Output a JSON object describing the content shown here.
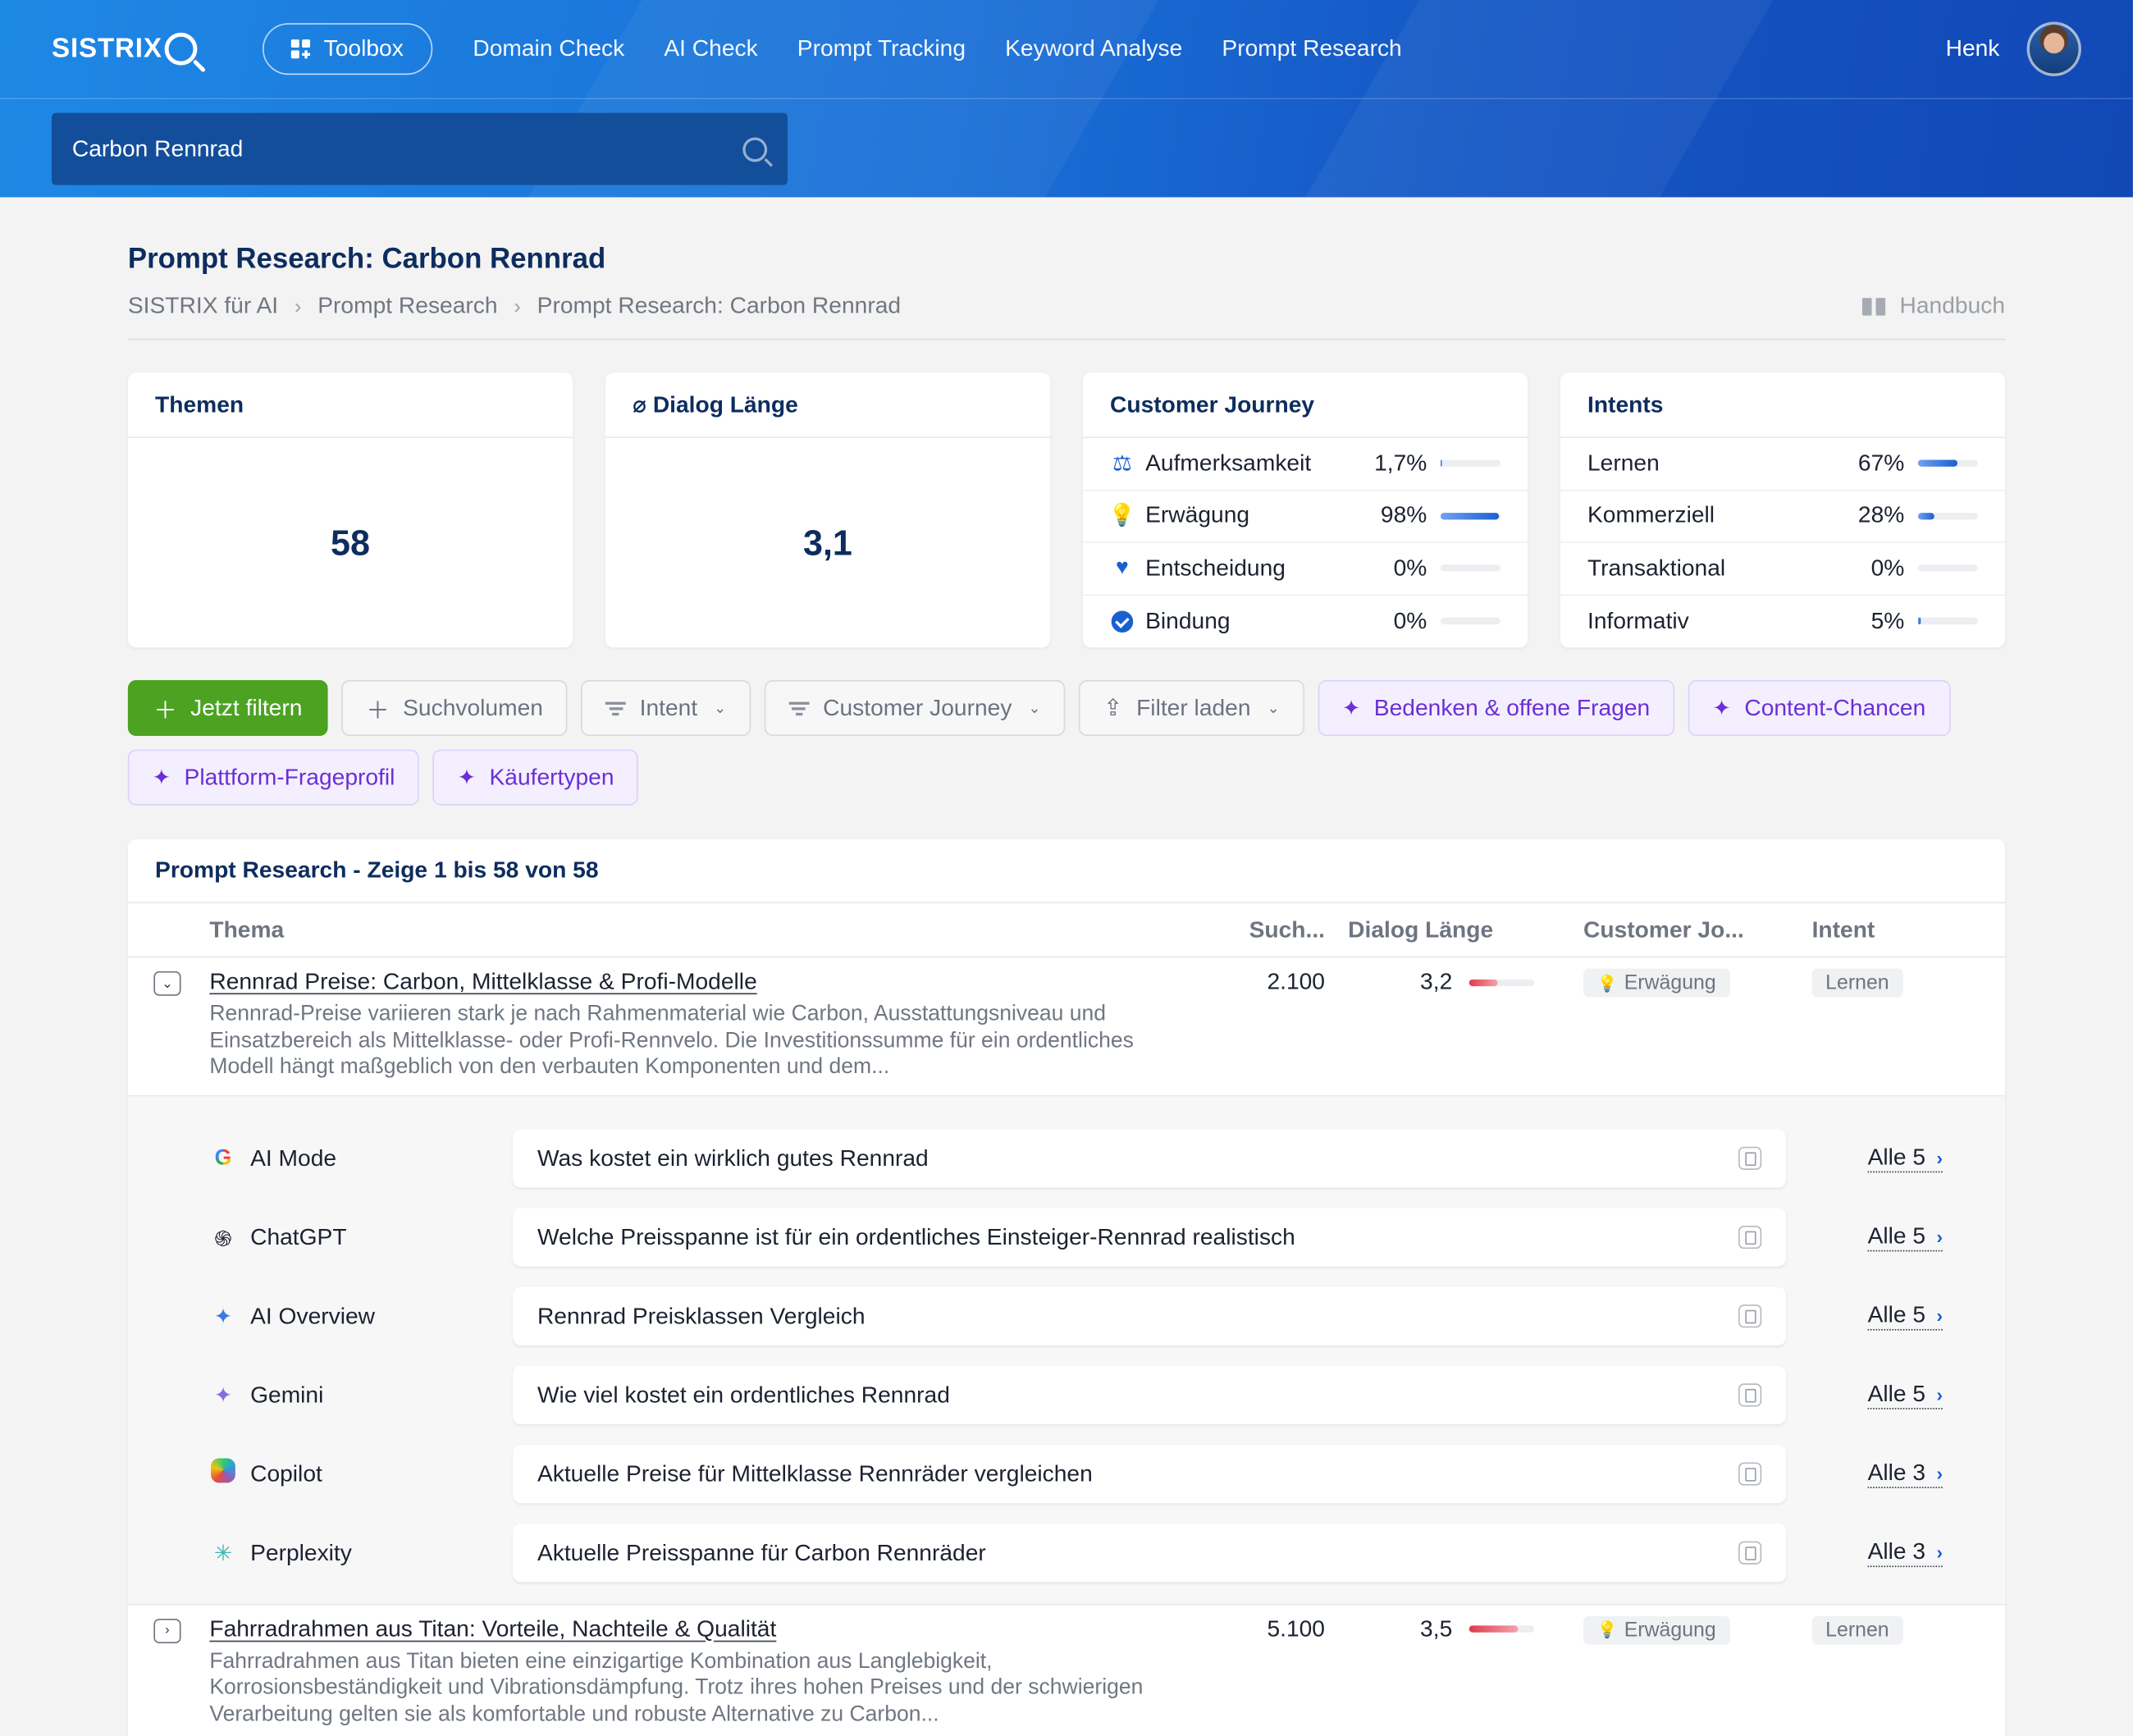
{
  "header": {
    "logo_text": "SISTRIX",
    "toolbox_label": "Toolbox",
    "nav": [
      "Domain Check",
      "AI Check",
      "Prompt Tracking",
      "Keyword Analyse",
      "Prompt Research"
    ],
    "user_name": "Henk",
    "search_value": "Carbon Rennrad"
  },
  "page": {
    "title": "Prompt Research: Carbon Rennrad",
    "breadcrumb": [
      "SISTRIX für AI",
      "Prompt Research",
      "Prompt Research: Carbon Rennrad"
    ],
    "handbook_label": "Handbuch"
  },
  "cards": {
    "themen": {
      "title": "Themen",
      "value": "58"
    },
    "dialog": {
      "title": "⌀ Dialog Länge",
      "value": "3,1"
    },
    "journey": {
      "title": "Customer Journey",
      "rows": [
        {
          "icon": "scale-icon",
          "label": "Aufmerksamkeit",
          "pct": "1,7%",
          "fraction": 0.017
        },
        {
          "icon": "bulb-icon",
          "label": "Erwägung",
          "pct": "98%",
          "fraction": 0.98
        },
        {
          "icon": "heart-icon",
          "label": "Entscheidung",
          "pct": "0%",
          "fraction": 0
        },
        {
          "icon": "check-circle-icon",
          "label": "Bindung",
          "pct": "0%",
          "fraction": 0
        }
      ]
    },
    "intents": {
      "title": "Intents",
      "rows": [
        {
          "label": "Lernen",
          "pct": "67%",
          "fraction": 0.67
        },
        {
          "label": "Kommerziell",
          "pct": "28%",
          "fraction": 0.28
        },
        {
          "label": "Transaktional",
          "pct": "0%",
          "fraction": 0
        },
        {
          "label": "Informativ",
          "pct": "5%",
          "fraction": 0.05
        }
      ]
    }
  },
  "filters": {
    "apply": "Jetzt filtern",
    "suchvolumen": "Suchvolumen",
    "intent": "Intent",
    "customer_journey": "Customer Journey",
    "filter_laden": "Filter laden",
    "bedenken": "Bedenken & offene Fragen",
    "content_chancen": "Content-Chancen",
    "plattform": "Plattform-Frageprofil",
    "kaeufertypen": "Käufertypen"
  },
  "table": {
    "title": "Prompt Research - Zeige 1 bis 58 von 58",
    "headers": {
      "thema": "Thema",
      "such": "Such...",
      "dialog": "Dialog Länge",
      "cj": "Customer Jo...",
      "intent": "Intent"
    },
    "rows": [
      {
        "topic": "Rennrad Preise: Carbon, Mittelklasse & Profi-Modelle",
        "description": "Rennrad-Preise variieren stark je nach Rahmenmaterial wie Carbon, Ausstattungsniveau und Einsatzbereich als Mittelklasse- oder Profi-Rennvelo. Die Investitionssumme für ein ordentliches Modell hängt maßgeblich von den verbauten Komponenten und dem...",
        "volume": "2.100",
        "dialog": "3,2",
        "dialog_fraction": 0.45,
        "journey": "Erwägung",
        "intent": "Lernen",
        "expanded": true
      },
      {
        "topic": "Fahrradrahmen aus Titan: Vorteile, Nachteile & Qualität",
        "description": "Fahrradrahmen aus Titan bieten eine einzigartige Kombination aus Langlebigkeit, Korrosionsbeständigkeit und Vibrationsdämpfung. Trotz ihres hohen Preises und der schwierigen Verarbeitung gelten sie als komfortable und robuste Alternative zu Carbon...",
        "volume": "5.100",
        "dialog": "3,5",
        "dialog_fraction": 0.75,
        "journey": "Erwägung",
        "intent": "Lernen",
        "expanded": false
      }
    ],
    "prompts": [
      {
        "platform": "AI Mode",
        "icon": "google-icon",
        "text": "Was kostet ein wirklich gutes Rennrad",
        "all": "Alle 5"
      },
      {
        "platform": "ChatGPT",
        "icon": "chatgpt-icon",
        "text": "Welche Preisspanne ist für ein ordentliches Einsteiger-Rennrad realistisch",
        "all": "Alle 5"
      },
      {
        "platform": "AI Overview",
        "icon": "ai-overview-icon",
        "text": "Rennrad Preisklassen Vergleich",
        "all": "Alle 5"
      },
      {
        "platform": "Gemini",
        "icon": "gemini-icon",
        "text": "Wie viel kostet ein ordentliches Rennrad",
        "all": "Alle 5"
      },
      {
        "platform": "Copilot",
        "icon": "copilot-icon",
        "text": "Aktuelle Preise für Mittelklasse Rennräder vergleichen",
        "all": "Alle 3"
      },
      {
        "platform": "Perplexity",
        "icon": "perplexity-icon",
        "text": "Aktuelle Preisspanne für Carbon Rennräder",
        "all": "Alle 3"
      }
    ]
  }
}
